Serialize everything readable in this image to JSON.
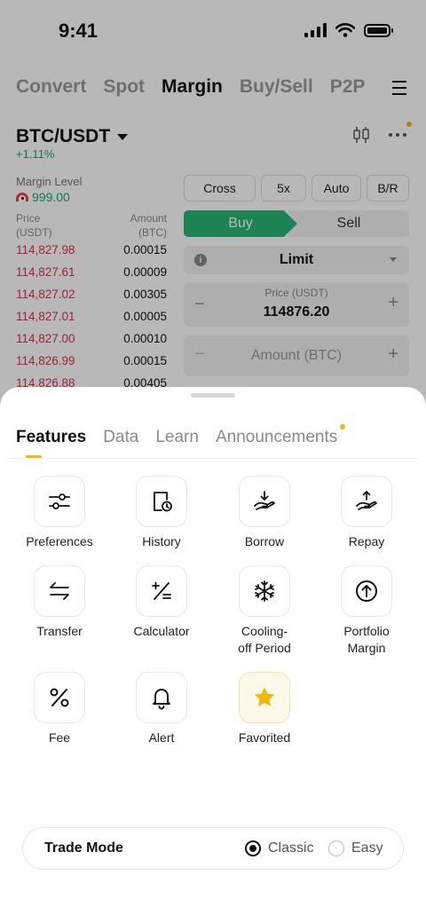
{
  "status_bar": {
    "time": "9:41"
  },
  "top_tabs": [
    {
      "label": "Convert",
      "active": false
    },
    {
      "label": "Spot",
      "active": false
    },
    {
      "label": "Margin",
      "active": true
    },
    {
      "label": "Buy/Sell",
      "active": false
    },
    {
      "label": "P2P",
      "active": false
    }
  ],
  "pair": {
    "symbol": "BTC/USDT",
    "change": "+1.11%"
  },
  "margin_level": {
    "label": "Margin Level",
    "value": "999.00"
  },
  "order_book": {
    "price_header": "Price\n(USDT)",
    "amount_header": "Amount\n(BTC)",
    "price_header_line1": "Price",
    "price_header_line2": "(USDT)",
    "amount_header_line1": "Amount",
    "amount_header_line2": "(BTC)",
    "rows": [
      {
        "price": "114,827.98",
        "amount": "0.00015"
      },
      {
        "price": "114,827.61",
        "amount": "0.00009"
      },
      {
        "price": "114,827.02",
        "amount": "0.00305"
      },
      {
        "price": "114,827.01",
        "amount": "0.00005"
      },
      {
        "price": "114,827.00",
        "amount": "0.00010"
      },
      {
        "price": "114,826.99",
        "amount": "0.00015"
      },
      {
        "price": "114,826.88",
        "amount": "0.00405"
      }
    ]
  },
  "order_form": {
    "mode_buttons": [
      "Cross",
      "5x",
      "Auto",
      "B/R"
    ],
    "buy_label": "Buy",
    "sell_label": "Sell",
    "order_type": "Limit",
    "price_label": "Price (USDT)",
    "price_value": "114876.20",
    "amount_placeholder": "Amount (BTC)",
    "info_icon": "info-icon",
    "minus": "−",
    "plus": "+"
  },
  "sheet": {
    "tabs": [
      {
        "label": "Features",
        "active": true
      },
      {
        "label": "Data",
        "active": false
      },
      {
        "label": "Learn",
        "active": false
      },
      {
        "label": "Announcements",
        "active": false,
        "badge": true
      }
    ],
    "features": [
      {
        "label": "Preferences",
        "icon": "sliders-icon"
      },
      {
        "label": "History",
        "icon": "history-icon"
      },
      {
        "label": "Borrow",
        "icon": "borrow-icon"
      },
      {
        "label": "Repay",
        "icon": "repay-icon"
      },
      {
        "label": "Transfer",
        "icon": "transfer-icon"
      },
      {
        "label": "Calculator",
        "icon": "calculator-icon"
      },
      {
        "label": "Cooling-\noff Period",
        "line1": "Cooling-",
        "line2": "off Period",
        "icon": "snowflake-icon"
      },
      {
        "label": "Portfolio\nMargin",
        "line1": "Portfolio",
        "line2": "Margin",
        "icon": "portfolio-icon"
      },
      {
        "label": "Fee",
        "icon": "percent-icon"
      },
      {
        "label": "Alert",
        "icon": "bell-icon"
      },
      {
        "label": "Favorited",
        "icon": "star-icon"
      }
    ],
    "trade_mode": {
      "label": "Trade Mode",
      "options": [
        {
          "label": "Classic",
          "selected": true
        },
        {
          "label": "Easy",
          "selected": false
        }
      ]
    }
  },
  "colors": {
    "accent": "#f0b90b",
    "buy": "#2ab673",
    "positive": "#1aa867",
    "ask_price": "#d9304f"
  }
}
